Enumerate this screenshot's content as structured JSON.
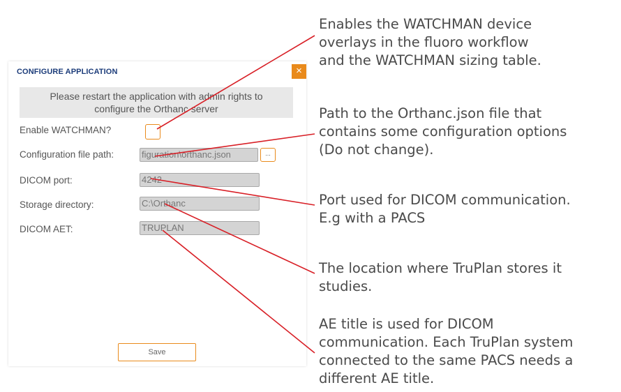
{
  "dialog": {
    "title": "CONFIGURE APPLICATION",
    "close_label": "×",
    "notice_line1": "Please restart the application with admin rights to",
    "notice_line2": "configure the Orthanc server",
    "fields": {
      "watchman_label": "Enable WATCHMAN?",
      "config_label": "Configuration file path:",
      "config_value": "figuration\\orthanc.json",
      "browse_label": "...",
      "port_label": "DICOM port:",
      "port_value": "4242",
      "storage_label": "Storage directory:",
      "storage_value": "C:\\Orthanc",
      "aet_label": "DICOM AET:",
      "aet_value": "TRUPLAN"
    },
    "save_label": "Save"
  },
  "annotations": {
    "watchman": [
      "Enables the WATCHMAN device",
      "overlays in the fluoro workflow",
      "and the WATCHMAN sizing table."
    ],
    "config": [
      "Path to the Orthanc.json file that",
      "contains some configuration options",
      "(Do not change)."
    ],
    "port": [
      "Port used for DICOM communication.",
      "E.g with a PACS"
    ],
    "storage": [
      "The location where TruPlan stores it",
      "studies."
    ],
    "aet": [
      "AE title is used for DICOM",
      "communication. Each TruPlan system",
      "connected to the same PACS needs a",
      "different AE title."
    ]
  },
  "colors": {
    "accent": "#e98a1b",
    "title": "#1c3c7a",
    "callout_line": "#d81f26"
  }
}
